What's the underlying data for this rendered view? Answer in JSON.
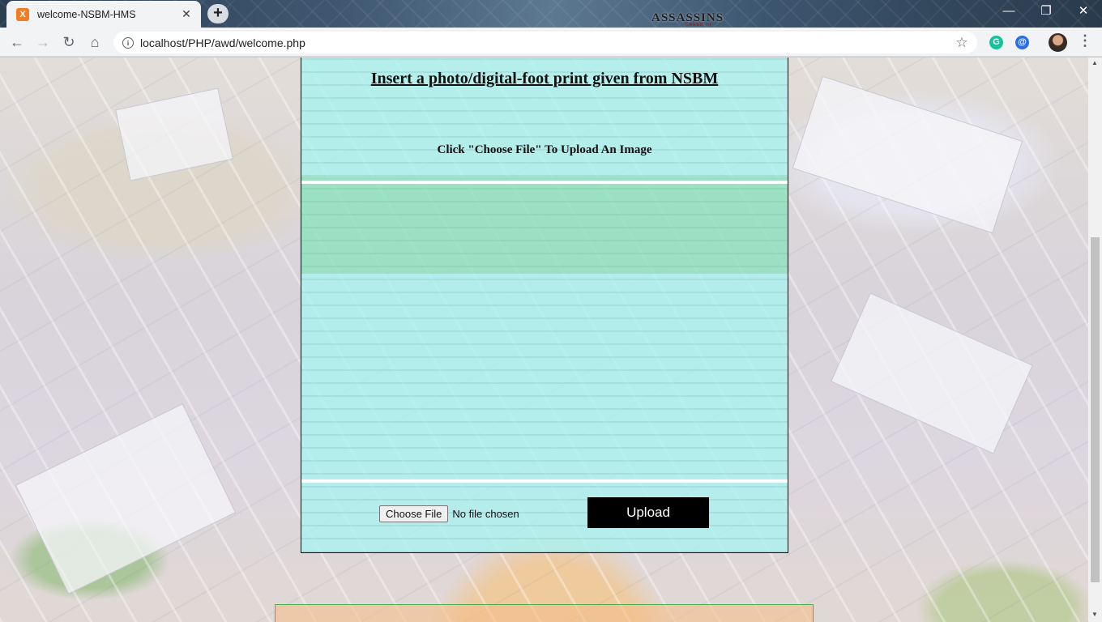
{
  "browser": {
    "tab_title": "welcome-NSBM-HMS",
    "tab_favicon": "X",
    "tab_close": "✕",
    "new_tab": "+",
    "theme_brand": "ASSASSINS",
    "theme_brand_sub": "CREED III",
    "window_controls": {
      "minimize": "—",
      "restore": "❐",
      "close": "✕"
    },
    "nav": {
      "back": "←",
      "forward": "→",
      "reload": "↻",
      "home": "⌂"
    },
    "info_glyph": "i",
    "url": "localhost/PHP/awd/welcome.php",
    "bookmark_star": "☆",
    "extensions": [
      {
        "name": "grammarly-icon",
        "glyph": "G",
        "color": "#15c39a"
      },
      {
        "name": "at-sign-extension-icon",
        "glyph": "@",
        "color": "#2d6ee6"
      }
    ],
    "menu_glyph": "⋮"
  },
  "panel": {
    "title": "Insert a photo/digital-foot print given from NSBM",
    "instruction": "Click \"Choose File\" To Upload An Image",
    "choose_file_label": "Choose File",
    "file_status": "No file chosen",
    "upload_label": "Upload"
  },
  "scrollbar": {
    "up": "▲",
    "down": "▼"
  },
  "colors": {
    "panel_background": "#a8f4f0",
    "upload_button": "#000000",
    "footer_border": "#4caf50"
  }
}
